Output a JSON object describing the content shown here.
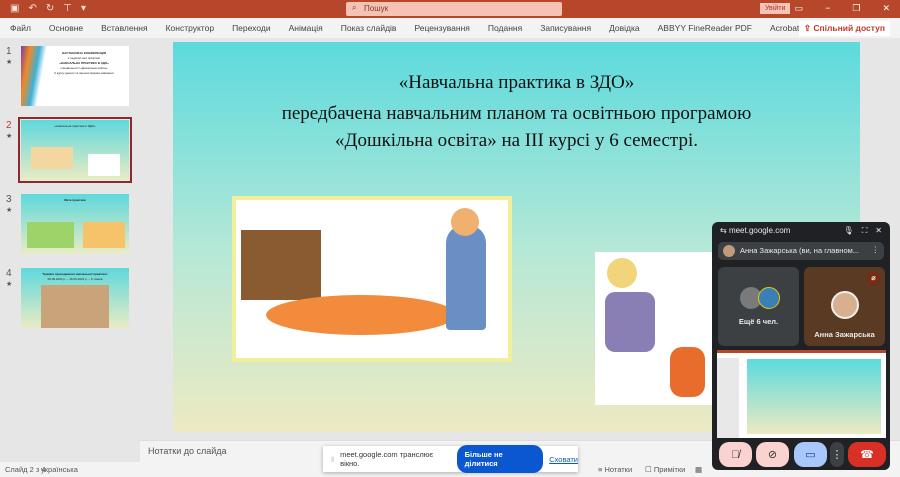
{
  "titlebar": {
    "doc_title": "ДО практика 3 курс  -  PowerPoint",
    "search_placeholder": "Пошук",
    "signin": "Увійти",
    "icons": [
      "save-icon",
      "undo-icon",
      "redo-icon",
      "present-icon"
    ]
  },
  "ribbon": {
    "tabs": [
      "Файл",
      "Основне",
      "Вставлення",
      "Конструктор",
      "Переходи",
      "Анімація",
      "Показ слайдів",
      "Рецензування",
      "Подання",
      "Записування",
      "Довідка",
      "ABBYY FineReader PDF",
      "Acrobat"
    ],
    "share": "Спільний доступ"
  },
  "slides": [
    {
      "num": "1",
      "lines": [
        "НАСТАНОВЧА КОНФЕРЕНЦІЯ",
        "з педагогічної практики",
        "«НАВЧАЛЬНА ПРАКТИКА В ЗДО»",
        "спеціальності «Дошкільна освіта»",
        "ІІ курсу денної та заочної форми навчання"
      ]
    },
    {
      "num": "2",
      "lines": [
        "«Навчальна практика в ЗДО»"
      ]
    },
    {
      "num": "3",
      "lines": [
        "Мета практики"
      ]
    },
    {
      "num": "4",
      "lines": [
        "Терміни проходження навчальної практики:",
        "06.09.2024 р. – 16.09.2024 р. – 6 тижнів"
      ]
    }
  ],
  "current_slide": {
    "line1": "«Навчальна практика в ЗДО»",
    "line2": "передбачена навчальним планом та освітньою програмою",
    "line3": "«Дошкільна освіта» на ІІІ курсі у 6 семестрі."
  },
  "notes_placeholder": "Нотатки до слайда",
  "status": {
    "slide": "Слайд 2 з 4",
    "language": "українська",
    "notes": "Нотатки",
    "comments": "Примітки"
  },
  "share_banner": {
    "text": "meet.google.com транслює вікно.",
    "stop": "Більше не ділитися",
    "hide": "Сховати"
  },
  "meet": {
    "url": "meet.google.com",
    "presenter": "Анна Зажарська (ви, на главном...",
    "more_people": "Ещё 6 чел.",
    "participant": "Анна Зажарська"
  }
}
